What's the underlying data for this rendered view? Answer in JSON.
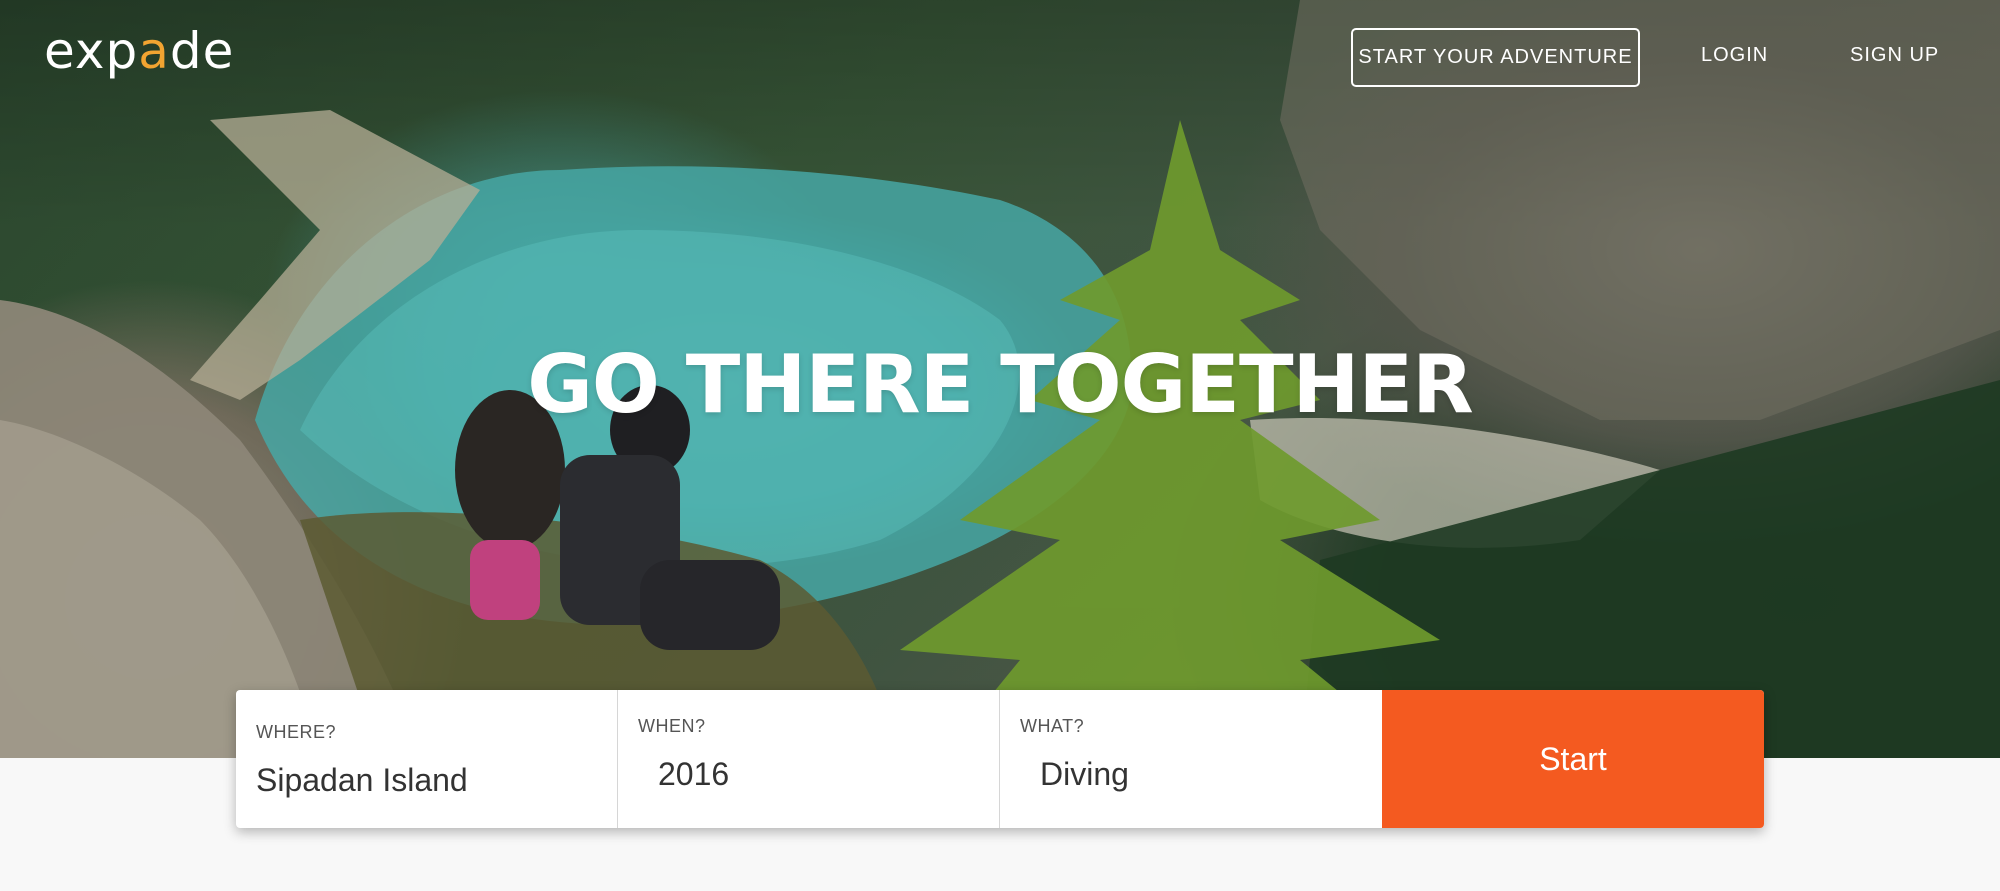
{
  "brand": {
    "logo_prefix": "exp",
    "logo_accent": "a",
    "logo_suffix": "de",
    "accent_color": "#f2a431"
  },
  "nav": {
    "start_adventure": "START YOUR ADVENTURE",
    "login": "LOGIN",
    "signup": "SIGN UP"
  },
  "hero": {
    "headline": "GO THERE TOGETHER"
  },
  "search": {
    "where_label": "WHERE?",
    "where_value": "Sipadan Island",
    "when_label": "WHEN?",
    "when_value": "2016",
    "what_label": "WHAT?",
    "what_value": "Diving",
    "start_label": "Start",
    "button_color": "#f45a20"
  }
}
